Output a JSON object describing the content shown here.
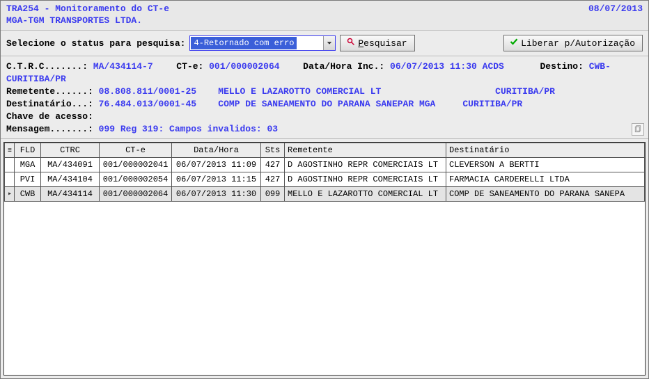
{
  "header": {
    "app_title": "TRA254 - Monitoramento do CT-e",
    "company": "MGA-TGM TRANSPORTES LTDA.",
    "date": "08/07/2013"
  },
  "filter": {
    "label": "Selecione o status para pesquisa:",
    "selected": "4-Retornado com erro",
    "search_btn": "Pesquisar",
    "search_btn_accel": "P",
    "authorize_btn": "Liberar p/Autorização"
  },
  "details": {
    "line1": {
      "ctrc_lbl": "C.T.R.C.......:",
      "ctrc_val": "MA/434114-7",
      "cte_lbl": "CT-e:",
      "cte_val": "001/000002064",
      "dthora_lbl": "Data/Hora Inc.:",
      "dthora_val": "06/07/2013 11:30 ACDS",
      "destino_lbl": "Destino:",
      "destino_val": "CWB-CURITIBA/PR"
    },
    "line2": {
      "rem_lbl": "Remetente......:",
      "rem_cnpj": "08.808.811/0001-25",
      "rem_nome": "MELLO E LAZAROTTO COMERCIAL LT",
      "rem_cidade": "CURITIBA/PR"
    },
    "line3": {
      "dest_lbl": "Destinatário...:",
      "dest_cnpj": "76.484.013/0001-45",
      "dest_nome": "COMP DE SANEAMENTO DO PARANA SANEPAR MGA",
      "dest_cidade": "CURITIBA/PR"
    },
    "line4": {
      "chave_lbl": "Chave de acesso:"
    },
    "line5": {
      "msg_lbl": "Mensagem.......:",
      "msg_val": "099  Reg 319: Campos invalidos: 03"
    }
  },
  "table": {
    "headers": {
      "mark": "",
      "fld": "FLD",
      "ctrc": "CTRC",
      "cte": "CT-e",
      "datahora": "Data/Hora",
      "sts": "Sts",
      "remetente": "Remetente",
      "destinatario": "Destinatário"
    },
    "rows": [
      {
        "mark": "",
        "fld": "MGA",
        "ctrc": "MA/434091",
        "cte": "001/000002041",
        "datahora": "06/07/2013 11:09",
        "sts": "427",
        "remetente": "D AGOSTINHO REPR COMERCIAIS LT",
        "destinatario": "CLEVERSON A BERTTI",
        "selected": false
      },
      {
        "mark": "",
        "fld": "PVI",
        "ctrc": "MA/434104",
        "cte": "001/000002054",
        "datahora": "06/07/2013 11:15",
        "sts": "427",
        "remetente": "D AGOSTINHO REPR COMERCIAIS LT",
        "destinatario": "FARMACIA CARDERELLI LTDA",
        "selected": false
      },
      {
        "mark": "▸",
        "fld": "CWB",
        "ctrc": "MA/434114",
        "cte": "001/000002064",
        "datahora": "06/07/2013 11:30",
        "sts": "099",
        "remetente": "MELLO E LAZAROTTO COMERCIAL LT",
        "destinatario": "COMP DE SANEAMENTO DO PARANA SANEPA",
        "selected": true
      }
    ]
  }
}
